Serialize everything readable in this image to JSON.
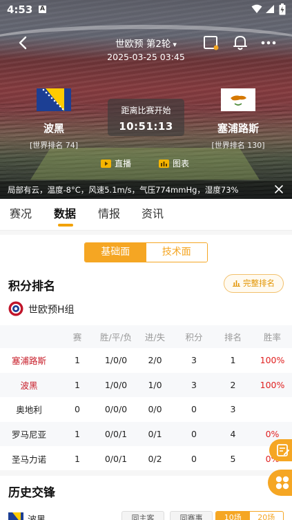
{
  "status_bar": {
    "time": "4:53",
    "notification": "A"
  },
  "header": {
    "title": "世欧预 第2轮",
    "datetime": "2025-03-25 03:45"
  },
  "match": {
    "home": {
      "name": "波黑",
      "rank": "[世界排名 74]"
    },
    "away": {
      "name": "塞浦路斯",
      "rank": "[世界排名 130]"
    },
    "countdown_label": "距离比赛开始",
    "countdown": "10:51:13",
    "live_label": "直播",
    "chart_label": "图表",
    "weather": "局部有云，温度-8°C，风速5.1m/s，气压774mmHg，湿度73%"
  },
  "tabs": [
    {
      "label": "赛况"
    },
    {
      "label": "数据"
    },
    {
      "label": "情报"
    },
    {
      "label": "资讯"
    }
  ],
  "data_tab": {
    "segments": [
      "基础面",
      "技术面"
    ],
    "active_segment": "基础面"
  },
  "standings": {
    "title": "积分排名",
    "full_button": "完整排名",
    "group": "世欧预H组",
    "columns": [
      "",
      "赛",
      "胜/平/负",
      "进/失",
      "积分",
      "排名",
      "胜率"
    ],
    "rows": [
      {
        "team": "塞浦路斯",
        "played": "1",
        "wdl": "1/0/0",
        "goals": "2/0",
        "points": "3",
        "rank": "1",
        "win_rate": "100%"
      },
      {
        "team": "波黑",
        "played": "1",
        "wdl": "1/0/0",
        "goals": "1/0",
        "points": "3",
        "rank": "2",
        "win_rate": "100%"
      },
      {
        "team": "奥地利",
        "played": "0",
        "wdl": "0/0/0",
        "goals": "0/0",
        "points": "0",
        "rank": "3",
        "win_rate": ""
      },
      {
        "team": "罗马尼亚",
        "played": "1",
        "wdl": "0/0/1",
        "goals": "0/1",
        "points": "0",
        "rank": "4",
        "win_rate": "0%"
      },
      {
        "team": "圣马力诺",
        "played": "1",
        "wdl": "0/0/1",
        "goals": "0/2",
        "points": "0",
        "rank": "5",
        "win_rate": "0%"
      }
    ]
  },
  "history": {
    "title": "历史交锋",
    "team": "波黑",
    "chip1": "同主客",
    "chip2": "同赛事",
    "range": [
      "10场",
      "20场"
    ]
  },
  "colors": {
    "accent": "#f5a623",
    "highlight_team": "#c8202c",
    "win_rate": "#e02020"
  }
}
